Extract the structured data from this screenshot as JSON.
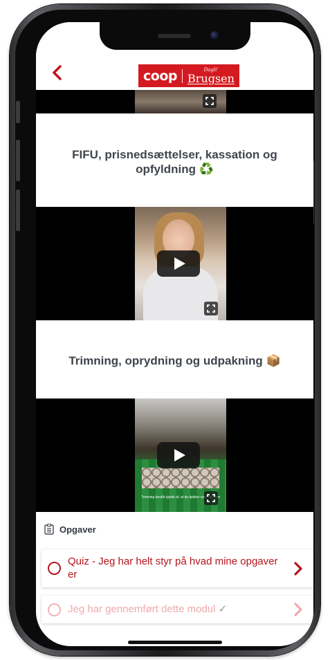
{
  "header": {
    "back_icon": "chevron-left-icon",
    "logo": {
      "coop": "coop",
      "dagli": "Dagli'",
      "brugsen": "Brugsen"
    }
  },
  "sections": [
    {
      "title": "FIFU, prisnedsættelser, kassation og opfyldning ♻️"
    },
    {
      "title": "Trimning, oprydning og udpakning 📦"
    }
  ],
  "video_caption": "Trimning består typisk af, at du tjekker varerne frem",
  "tasks": {
    "label": "Opgaver",
    "items": [
      {
        "text": "Quiz - Jeg  har helt styr på hvad mine opgaver er",
        "enabled": true
      },
      {
        "text": "Jeg har gennemført dette modul",
        "check": "✓",
        "enabled": false
      }
    ]
  },
  "colors": {
    "brand_red": "#d41a20",
    "task_red": "#b3141c",
    "task_disabled": "#f0a9ad",
    "title_gray": "#3f454d"
  }
}
